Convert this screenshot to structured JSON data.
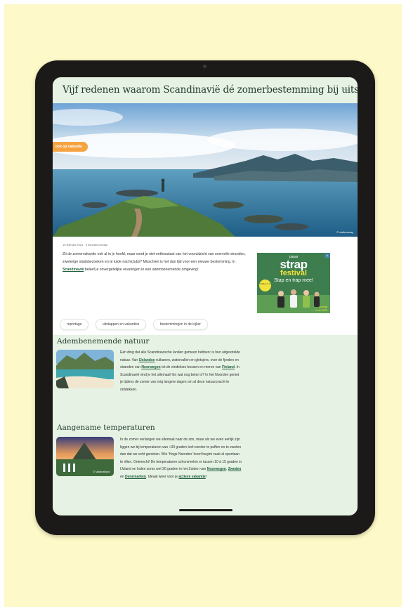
{
  "article": {
    "title": "Vijf redenen waarom Scandinavië dé zomerbestemming bij uitstek is",
    "close": "×",
    "badge": "ook op vakantie",
    "photo_credit": "© visitnorway",
    "meta": "10 februari 2024  ·  3 minuten leestijd",
    "intro_a": "Zit de zomervakantie ook al in je hoofd, maar word je niet enthousiast van het vooruitzicht van overvolle stranden, zweterige stadsbezoeken en te luide nachtclubs? Misschien is het dan tijd voor een nieuwe bestemming. In ",
    "intro_link": "Scandinavië",
    "intro_b": " beleef je onvergetelijke ervaringen in een adembenemende omgeving!",
    "tags": [
      "reportage",
      "uitstappen en vakanties",
      "bestemmingen in de kijker"
    ]
  },
  "ad": {
    "close": "x",
    "small": "pasar",
    "brand": "strap",
    "festival": "festival",
    "slogan": "Stap en trap mee!",
    "round": "schrijf je nu in!",
    "date_line1": "zondag",
    "date_line2": "4 mei 2025",
    "colors": {
      "bg": "#3d7d4e",
      "accent": "#f3e23b"
    }
  },
  "sections": [
    {
      "heading": "Adembenemende natuur",
      "p1": "Eén ding dat alle Scandinavische landen gemeen hebben: is hun uitgestrekte natuur. Van ",
      "l1": "IJslandse",
      "p2": " vulkanen, watervallen en gletsjers, over de fjorden en stranden van ",
      "l2": "Noorwegen",
      "p3": " tot de eindeloze bossen en meren van ",
      "l3": "Finland",
      "p4": ". In Scandinavië vind je het allemaal! En wat nog beter is? In het Noorden geniet je tijdens de zomer van nóg langere dagen om al deze natuurpracht te ontdekken.",
      "credit": "© visitnorway"
    },
    {
      "heading": "Aangename temperaturen",
      "p1": "In de zomer verlangen we allemaal naar de zon, maar als we even eerlijk zijn liggen we bij temperaturen van +30 graden toch eerder te puffen en te zweten dan dat we echt genieten. Wie 'Hoge Noorden' hoort begint vaak al spontaan te rillen. Onterecht! De temperaturen schommelen er tussen 10 à 15 graden in IJsland en halen soms wel 30 graden in het Zuiden van ",
      "l1": "Noorwegen",
      "p2": ", ",
      "l2": "Zweden",
      "p3": " en ",
      "l3": "Denemarken",
      "p4": ". Ideaal weer voor je ",
      "l4": "actieve vakantie",
      "p5": "!",
      "credit": "© visiticeland"
    }
  ],
  "colors": {
    "poster": "#fef9c8",
    "tablet": "#1b1a18",
    "screen": "#e6f2e4",
    "heading": "#1f3a2c",
    "link": "#1f5e3c",
    "badge": "#f5a340"
  }
}
